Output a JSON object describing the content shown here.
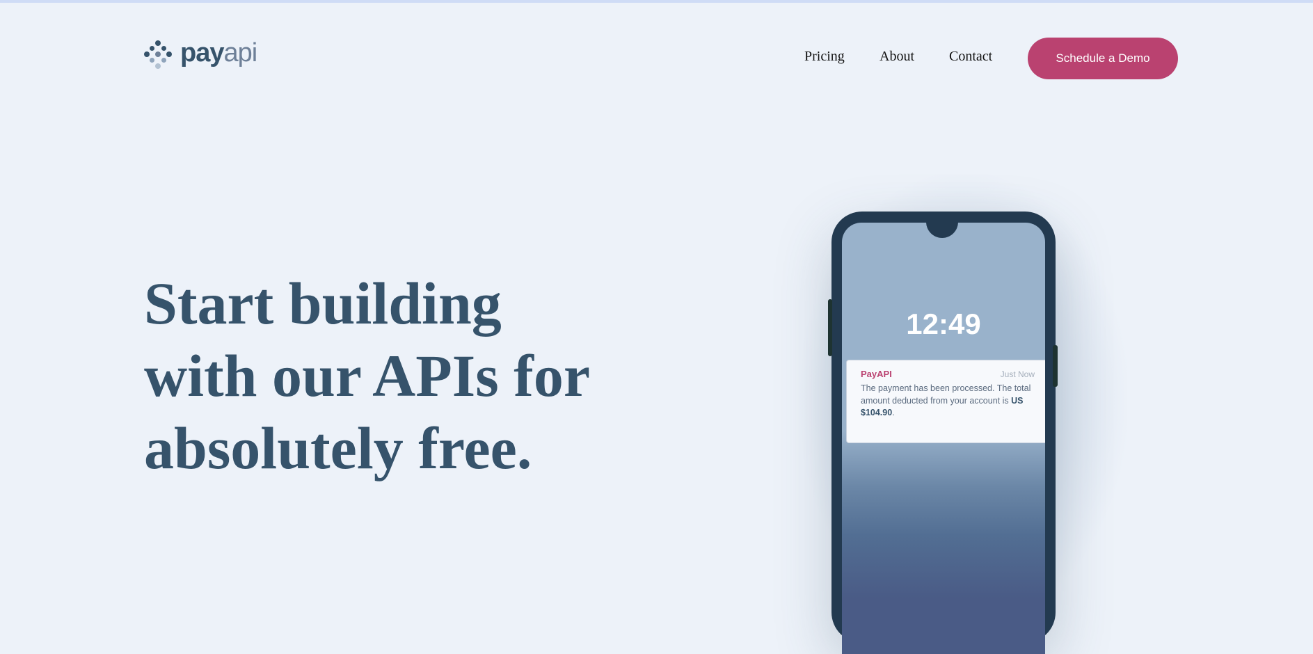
{
  "brand": {
    "logo_text_bold": "pay",
    "logo_text_light": "api",
    "colors": {
      "primary_dark": "#36536b",
      "accent": "#ba4270",
      "background": "#edf2f9"
    }
  },
  "nav": {
    "items": [
      {
        "label": "Pricing"
      },
      {
        "label": "About"
      },
      {
        "label": "Contact"
      }
    ],
    "cta_label": "Schedule a Demo"
  },
  "hero": {
    "title_lines": [
      "Start building",
      "with our APIs for",
      "absolutely free."
    ]
  },
  "phone": {
    "clock": "12:49",
    "notification": {
      "app_name": "PayAPI",
      "time": "Just Now",
      "message": "The payment has been processed. The total amount deducted from your account is ",
      "amount": "US $104.90",
      "suffix": "."
    }
  }
}
